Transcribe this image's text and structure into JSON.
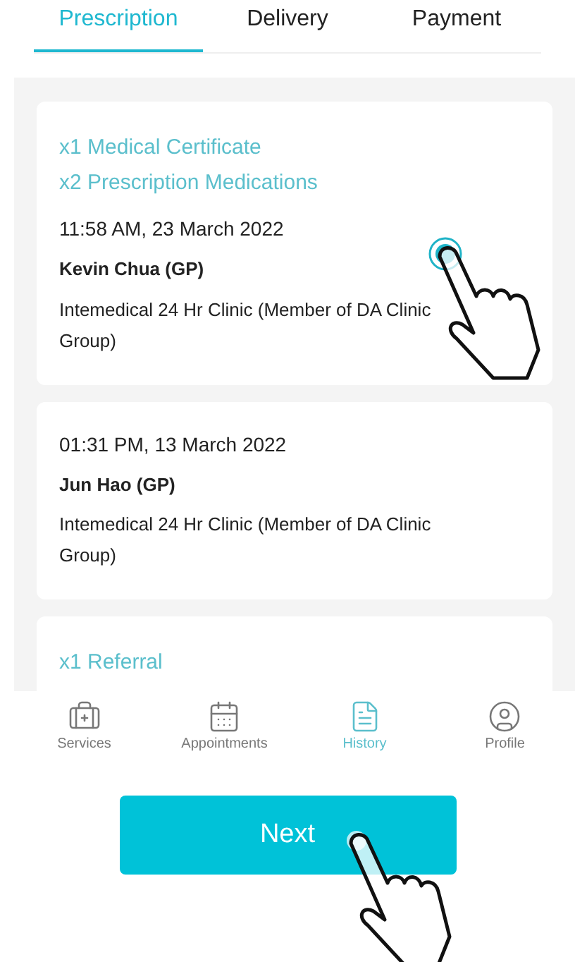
{
  "tabs": [
    {
      "label": "Prescription",
      "selected": true
    },
    {
      "label": "Delivery",
      "selected": false
    },
    {
      "label": "Payment",
      "selected": false
    }
  ],
  "cards": [
    {
      "items": [
        "x1 Medical Certificate",
        "x2 Prescription Medications"
      ],
      "time": "11:58 AM, 23 March 2022",
      "doctor": "Kevin Chua (GP)",
      "clinic": "Intemedical 24 Hr Clinic (Member of DA Clinic Group)"
    },
    {
      "time": "01:31 PM, 13 March 2022",
      "doctor": "Jun Hao (GP)",
      "clinic": "Intemedical 24 Hr Clinic (Member of DA Clinic Group)"
    },
    {
      "items": [
        "x1 Referral"
      ]
    }
  ],
  "nav": [
    {
      "kind": "services",
      "label": "Services",
      "selected": false
    },
    {
      "kind": "appointments",
      "label": "Appointments",
      "selected": false
    },
    {
      "kind": "history",
      "label": "History",
      "selected": true
    },
    {
      "kind": "profile",
      "label": "Profile",
      "selected": false
    }
  ],
  "next_button": {
    "label": "Next"
  }
}
